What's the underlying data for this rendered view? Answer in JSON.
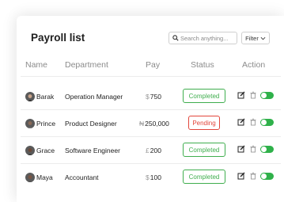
{
  "title": "Payroll list",
  "search": {
    "placeholder": "Search anything..."
  },
  "filter": {
    "label": "Filter"
  },
  "columns": {
    "name": "Name",
    "department": "Department",
    "pay": "Pay",
    "status": "Status",
    "action": "Action"
  },
  "rows": [
    {
      "name": "Barak",
      "department": "Operation Manager",
      "currency": "$",
      "amount": "750",
      "status": "Completed",
      "status_type": "completed"
    },
    {
      "name": "Prince",
      "department": "Product Designer",
      "currency": "₦",
      "amount": "250,000",
      "status": "Pending",
      "status_type": "pending"
    },
    {
      "name": "Grace",
      "department": "Software Engineer",
      "currency": "£",
      "amount": "200",
      "status": "Completed",
      "status_type": "completed"
    },
    {
      "name": "Maya",
      "department": "Accountant",
      "currency": "$",
      "amount": "100",
      "status": "Completed",
      "status_type": "completed"
    }
  ],
  "colors": {
    "completed": "#3fae4e",
    "pending": "#e2463b",
    "toggle": "#2fb14a"
  },
  "icons": {
    "search": "search-icon",
    "filter": "chevron-down-icon",
    "edit": "edit-icon",
    "delete": "trash-icon",
    "toggle": "toggle-switch"
  }
}
